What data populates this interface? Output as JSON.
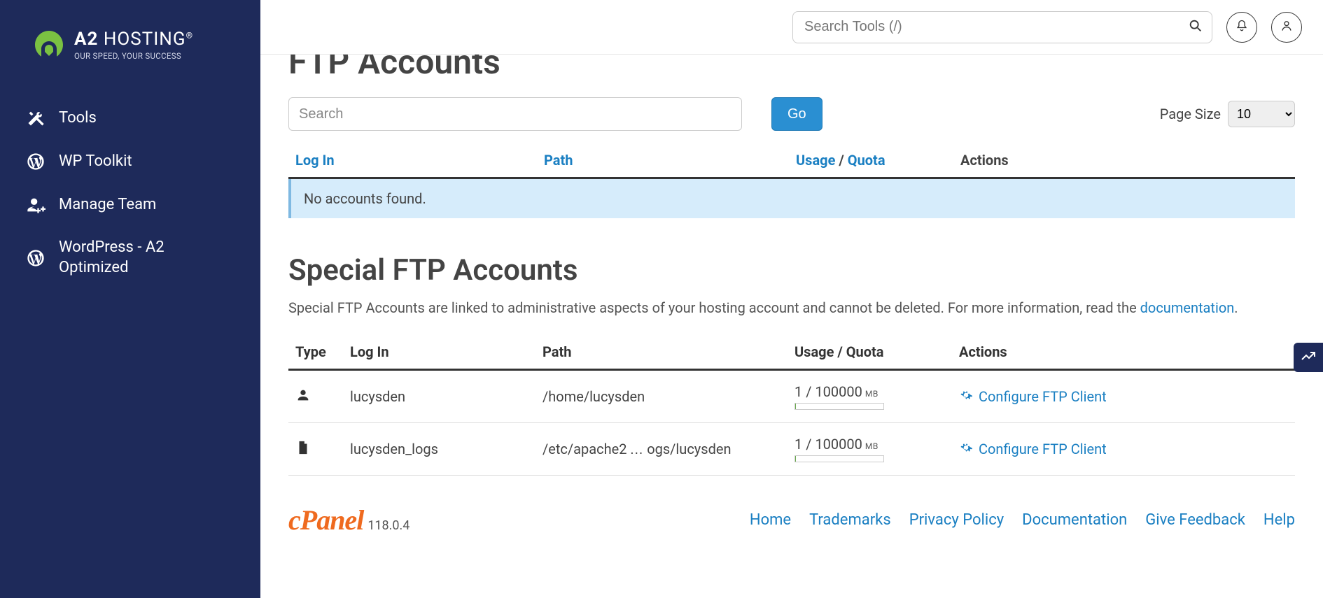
{
  "brand": {
    "name_a": "A2",
    "name_b": "HOSTING",
    "tagline": "OUR SPEED, YOUR SUCCESS"
  },
  "sidebar": {
    "items": [
      {
        "label": "Tools"
      },
      {
        "label": "WP Toolkit"
      },
      {
        "label": "Manage Team"
      },
      {
        "label": "WordPress - A2 Optimized"
      }
    ]
  },
  "topbar": {
    "search_placeholder": "Search Tools (/)"
  },
  "ftp": {
    "title": "FTP Accounts",
    "search_placeholder": "Search",
    "go_label": "Go",
    "page_size_label": "Page Size",
    "page_size_value": "10",
    "cols": {
      "login": "Log In",
      "path": "Path",
      "usage": "Usage",
      "quota": "Quota",
      "actions": "Actions"
    },
    "empty_msg": "No accounts found."
  },
  "special": {
    "title": "Special FTP Accounts",
    "desc_pre": "Special FTP Accounts are linked to administrative aspects of your hosting account and cannot be deleted. For more information, read the ",
    "doc_link": "documentation",
    "desc_post": ".",
    "cols": {
      "type": "Type",
      "login": "Log In",
      "path": "Path",
      "usage_quota": "Usage / Quota",
      "actions": "Actions"
    },
    "rows": [
      {
        "type": "user",
        "login": "lucysden",
        "path": "/home/lucysden",
        "usage": "1",
        "quota": "100000",
        "unit": "MB",
        "action": "Configure FTP Client"
      },
      {
        "type": "file",
        "login": "lucysden_logs",
        "path_a": "/etc/apache2",
        "path_ellipsis": "...",
        "path_b": "ogs/lucysden",
        "usage": "1",
        "quota": "100000",
        "unit": "MB",
        "action": "Configure FTP Client"
      }
    ]
  },
  "footer": {
    "brand": "cPanel",
    "version": "118.0.4",
    "links": [
      "Home",
      "Trademarks",
      "Privacy Policy",
      "Documentation",
      "Give Feedback",
      "Help"
    ]
  }
}
